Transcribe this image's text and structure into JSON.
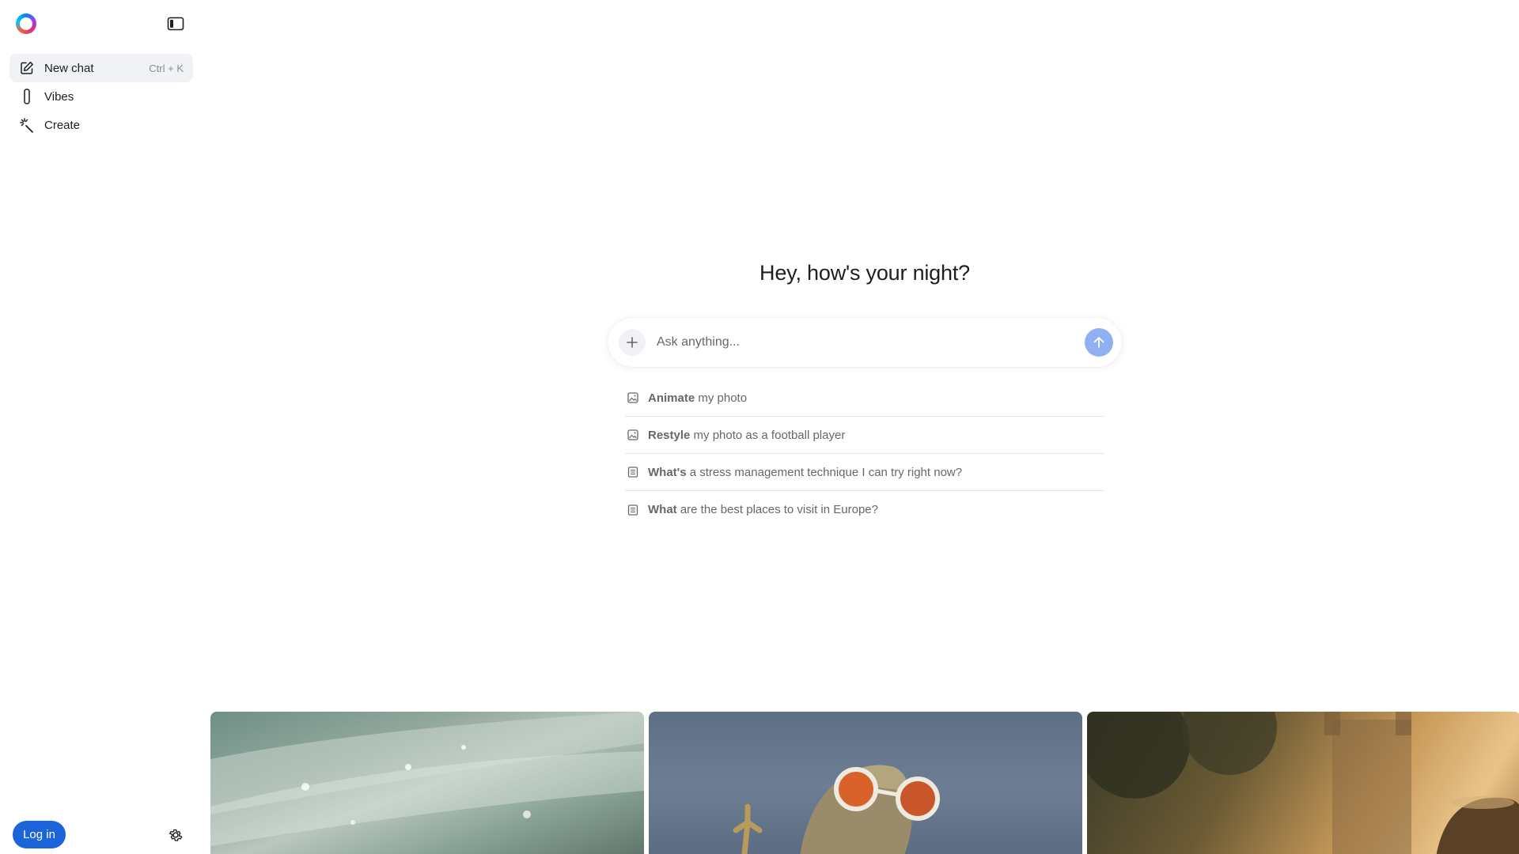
{
  "sidebar": {
    "logo_icon": "meta-ai-ring-icon",
    "items": [
      {
        "label": "New chat",
        "shortcut": "Ctrl + K",
        "icon": "edit-icon"
      },
      {
        "label": "Vibes",
        "icon": "phone-icon"
      },
      {
        "label": "Create",
        "icon": "sparkle-wand-icon"
      }
    ],
    "login_label": "Log in"
  },
  "main": {
    "greeting": "Hey, how's your night?",
    "composer": {
      "placeholder": "Ask anything..."
    },
    "suggestions": [
      {
        "bold": "Animate",
        "rest": " my photo",
        "icon": "image-icon"
      },
      {
        "bold": "Restyle",
        "rest": " my photo as a football player",
        "icon": "image-icon"
      },
      {
        "bold": "What's",
        "rest": " a stress management technique I can try right now?",
        "icon": "document-icon"
      },
      {
        "bold": "What",
        "rest": " are the best places to visit in Europe?",
        "icon": "document-icon"
      }
    ]
  },
  "colors": {
    "accent": "#1b64da",
    "send_button": "#8fb0f2"
  }
}
